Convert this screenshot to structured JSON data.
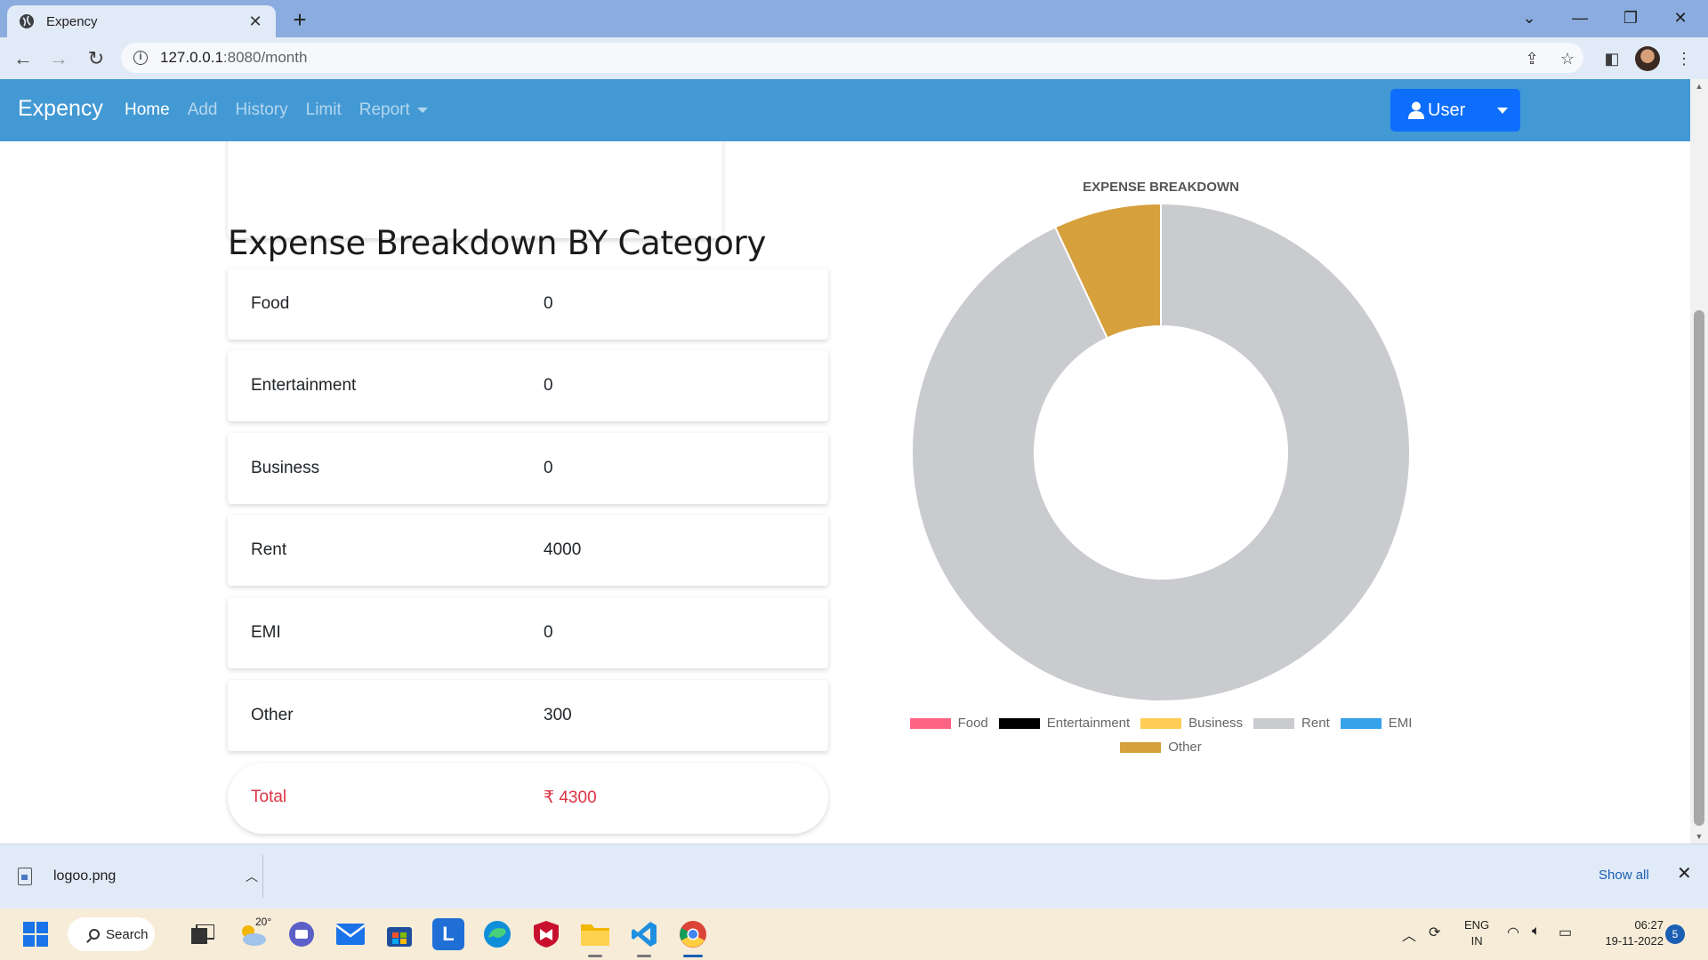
{
  "browser": {
    "tab_title": "Expency",
    "url_host": "127.0.0.1",
    "url_rest": ":8080/month"
  },
  "app": {
    "brand": "Expency",
    "nav": [
      {
        "label": "Home",
        "active": true
      },
      {
        "label": "Add",
        "active": false
      },
      {
        "label": "History",
        "active": false
      },
      {
        "label": "Limit",
        "active": false
      },
      {
        "label": "Report",
        "active": false
      }
    ],
    "user_button": "User"
  },
  "breakdown": {
    "title": "Expense Breakdown BY Category",
    "rows": [
      {
        "name": "Food",
        "value": "0"
      },
      {
        "name": "Entertainment",
        "value": "0"
      },
      {
        "name": "Business",
        "value": "0"
      },
      {
        "name": "Rent",
        "value": "4000"
      },
      {
        "name": "EMI",
        "value": "0"
      },
      {
        "name": "Other",
        "value": "300"
      }
    ],
    "total_label": "Total",
    "total_value": "₹ 4300"
  },
  "chart_data": {
    "type": "pie",
    "variant": "doughnut",
    "title": "EXPENSE BREAKDOWN",
    "categories": [
      "Food",
      "Entertainment",
      "Business",
      "Rent",
      "EMI",
      "Other"
    ],
    "values": [
      0,
      0,
      0,
      4000,
      0,
      300
    ],
    "colors": [
      "#ff6384",
      "#000000",
      "#ffcd56",
      "#c9cbcf",
      "#36a2eb",
      "#d6a03d"
    ],
    "legend_position": "bottom"
  },
  "downloads": {
    "file_name": "logoo.png",
    "show_all": "Show all"
  },
  "taskbar": {
    "search_label": "Search",
    "weather_temp": "20°",
    "lang_line1": "ENG",
    "lang_line2": "IN",
    "time": "06:27",
    "date": "19-11-2022",
    "notification_count": "5"
  }
}
